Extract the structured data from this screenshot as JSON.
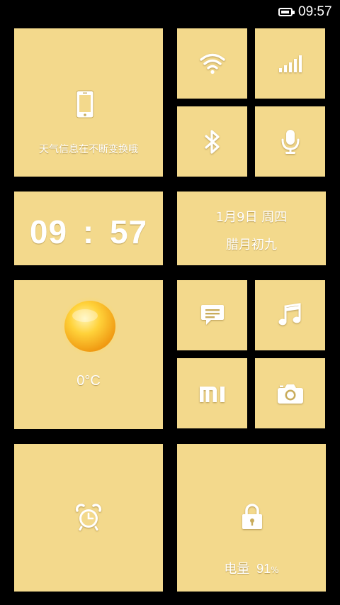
{
  "status_bar": {
    "time": "09:57",
    "battery_level_percent": 91
  },
  "tiles": {
    "phone_info": {
      "icon": "phone-icon",
      "label": "天气信息在不断变换哦"
    },
    "wifi": {
      "icon": "wifi-icon"
    },
    "signal": {
      "icon": "signal-bars-icon"
    },
    "bluetooth": {
      "icon": "bluetooth-icon"
    },
    "microphone": {
      "icon": "microphone-icon"
    },
    "clock": {
      "hours": "09",
      "separator": ":",
      "minutes": "57"
    },
    "date": {
      "solar": "1月9日 周四",
      "lunar": "腊月初九"
    },
    "weather": {
      "icon": "sun-icon",
      "temperature": "0°C"
    },
    "messages": {
      "icon": "message-icon"
    },
    "music": {
      "icon": "music-note-icon"
    },
    "mi": {
      "icon": "mi-logo-icon"
    },
    "camera": {
      "icon": "camera-icon"
    },
    "alarm": {
      "icon": "alarm-clock-icon"
    },
    "lock": {
      "icon": "lock-icon",
      "battery_label": "电量",
      "battery_value": "91",
      "battery_unit": "%"
    }
  },
  "colors": {
    "background": "#000000",
    "tile": "#f3d98c",
    "text": "#ffffff"
  }
}
